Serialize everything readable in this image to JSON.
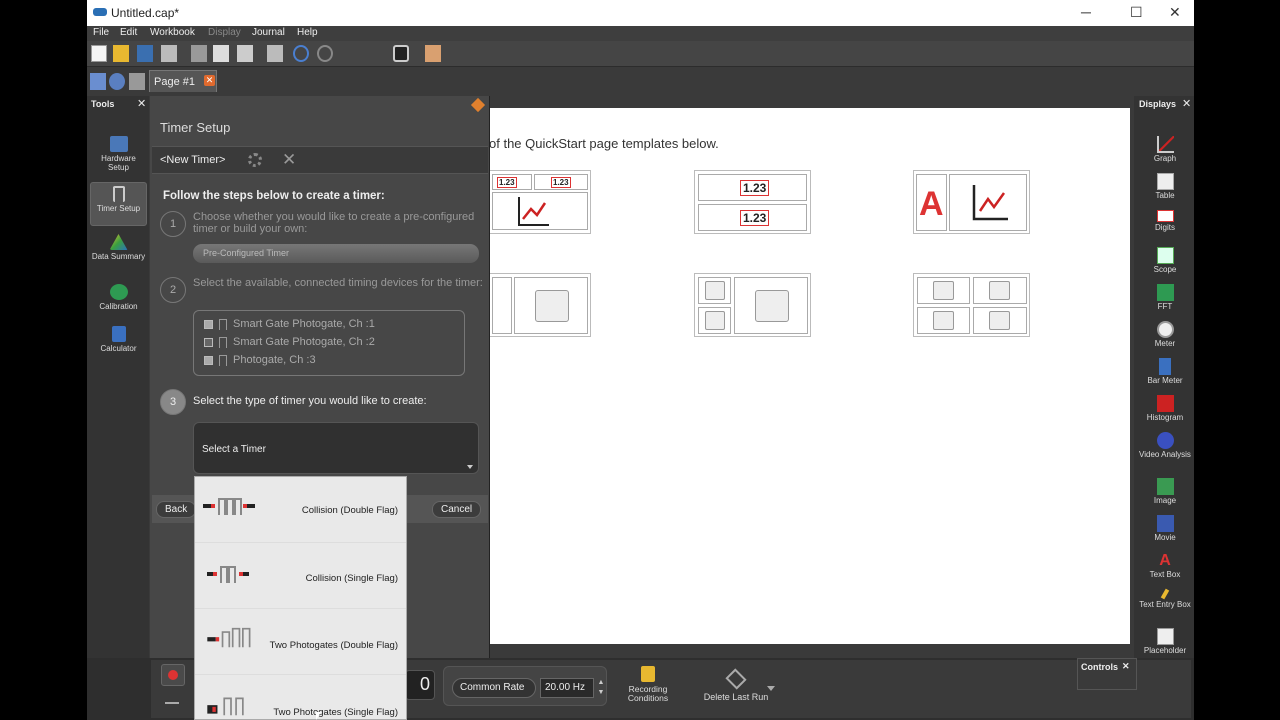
{
  "window": {
    "title": "Untitled.cap*",
    "minimize": "─",
    "maximize": "☐",
    "close": "✕"
  },
  "menu": [
    "File",
    "Edit",
    "Workbook",
    "Display",
    "Journal",
    "Help"
  ],
  "tab": {
    "label": "Page #1",
    "close": "✕"
  },
  "tools": {
    "header": "Tools",
    "items": [
      "Hardware Setup",
      "Timer Setup",
      "Data Summary",
      "Calibration",
      "Calculator"
    ]
  },
  "canvas": {
    "quickstart_text": "of the QuickStart page templates below.",
    "digit_value": "1.23",
    "text_box_letter": "A"
  },
  "timer_setup": {
    "title": "Timer Setup",
    "new_timer": "<New Timer>",
    "close_x": "✕",
    "follow": "Follow the steps below to create a timer:",
    "step1_num": "1",
    "step1_text": "Choose whether you would like to create a pre-configured timer or build your own:",
    "step1_choice": "Pre-Configured Timer",
    "step2_num": "2",
    "step2_text": "Select the available, connected timing devices for the timer:",
    "devices": [
      {
        "label": "Smart Gate Photogate, Ch :1",
        "checked": true
      },
      {
        "label": "Smart Gate Photogate, Ch :2",
        "checked": false
      },
      {
        "label": "Photogate, Ch :3",
        "checked": true
      }
    ],
    "step3_num": "3",
    "step3_text": "Select the type of timer you would like to create:",
    "select_placeholder": "Select a Timer",
    "back": "Back",
    "cancel": "Cancel"
  },
  "timer_options": [
    "Collision (Double Flag)",
    "Collision (Single Flag)",
    "Two Photogates (Double Flag)",
    "Two Photogates (Single Flag)"
  ],
  "bottom": {
    "counter": "0",
    "rate_mode": "Common Rate",
    "rate_value": "20.00 Hz",
    "recording_conditions": "Recording Conditions",
    "delete_last_run": "Delete Last Run"
  },
  "displays": {
    "header": "Displays",
    "items": [
      "Graph",
      "Table",
      "Digits",
      "Scope",
      "FFT",
      "Meter",
      "Bar Meter",
      "Histogram",
      "Video Analysis",
      "Image",
      "Movie",
      "Text Box",
      "Text Entry Box",
      "Placeholder"
    ]
  },
  "controls": {
    "header": "Controls"
  },
  "colors": {
    "accent_red": "#d33333",
    "chart_red": "#cc2222",
    "close_orange": "#e06a2e"
  }
}
